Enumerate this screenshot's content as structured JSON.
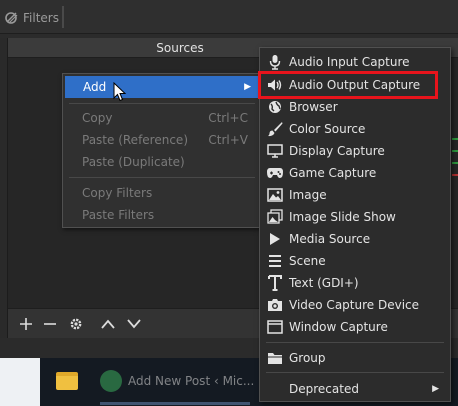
{
  "toolbar": {
    "filters_label": "Filters"
  },
  "sources_dock": {
    "title": "Sources",
    "footer_buttons": [
      "add",
      "remove",
      "settings",
      "move-up",
      "move-down"
    ]
  },
  "context_menu": {
    "items": [
      {
        "label": "Add",
        "shortcut": "",
        "enabled": true,
        "highlighted": true,
        "has_submenu": true
      },
      {
        "label": "Copy",
        "shortcut": "Ctrl+C",
        "enabled": false
      },
      {
        "label": "Paste (Reference)",
        "shortcut": "Ctrl+V",
        "enabled": false
      },
      {
        "label": "Paste (Duplicate)",
        "shortcut": "",
        "enabled": false
      },
      {
        "label": "Copy Filters",
        "shortcut": "",
        "enabled": false
      },
      {
        "label": "Paste Filters",
        "shortcut": "",
        "enabled": false
      }
    ]
  },
  "add_submenu": {
    "items": [
      {
        "label": "Audio Input Capture",
        "icon": "microphone-icon"
      },
      {
        "label": "Audio Output Capture",
        "icon": "speaker-icon",
        "highlighted_box": true
      },
      {
        "label": "Browser",
        "icon": "globe-icon"
      },
      {
        "label": "Color Source",
        "icon": "paint-brush-icon"
      },
      {
        "label": "Display Capture",
        "icon": "monitor-icon"
      },
      {
        "label": "Game Capture",
        "icon": "gamepad-icon"
      },
      {
        "label": "Image",
        "icon": "image-icon"
      },
      {
        "label": "Image Slide Show",
        "icon": "slideshow-icon"
      },
      {
        "label": "Media Source",
        "icon": "play-icon"
      },
      {
        "label": "Scene",
        "icon": "list-icon"
      },
      {
        "label": "Text (GDI+)",
        "icon": "text-icon"
      },
      {
        "label": "Video Capture Device",
        "icon": "camera-icon"
      },
      {
        "label": "Window Capture",
        "icon": "window-icon"
      },
      {
        "label": "Group",
        "icon": "folder-icon"
      },
      {
        "label": "Deprecated",
        "icon": "",
        "has_submenu": true
      }
    ]
  },
  "taskbar": {
    "item_label": "Add New Post ‹ Mic..."
  },
  "colors": {
    "menu_highlight": "#2f6fc8",
    "callout_box": "#e8141c",
    "menu_bg": "#2c2c2c"
  }
}
